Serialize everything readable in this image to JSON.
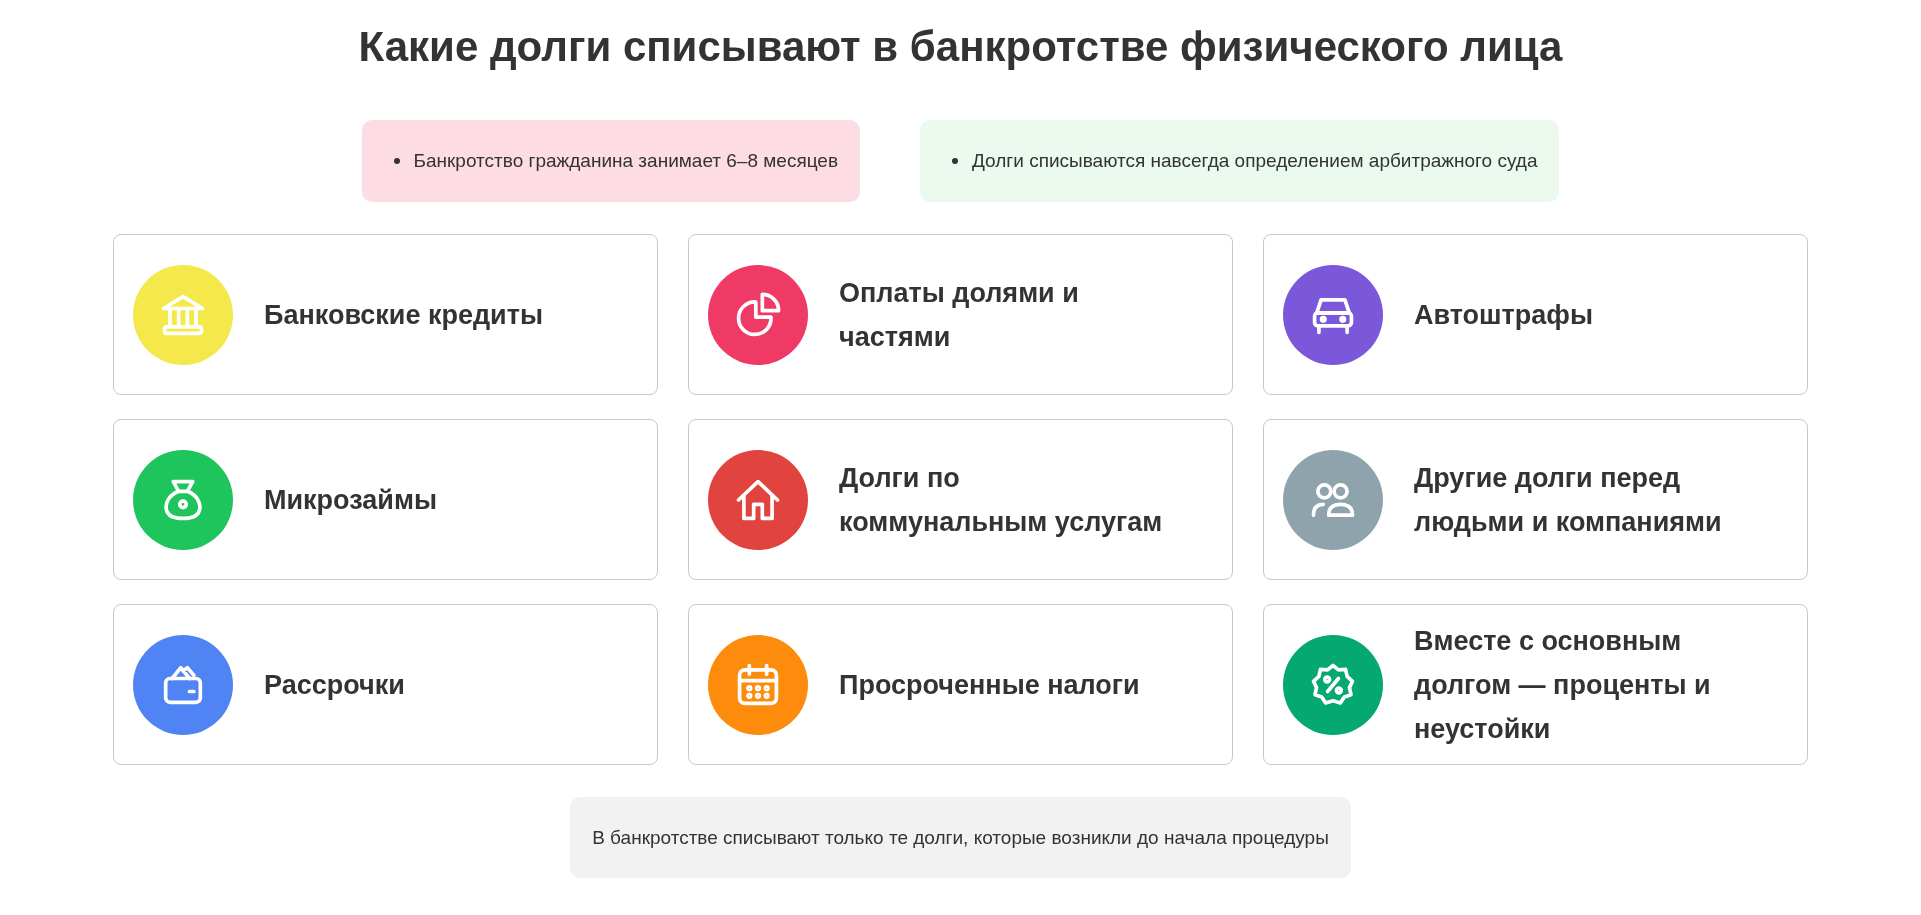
{
  "title": "Какие долги списывают в банкротстве физического лица",
  "notes": [
    {
      "text": "Банкротство гражданина занимает 6–8 месяцев",
      "color": "#fddde3"
    },
    {
      "text": "Долги списываются навсегда определением арбитражного суда",
      "color": "#ebf9ef"
    }
  ],
  "cards": [
    {
      "label": "Банковские кредиты",
      "color": "#f5e84a"
    },
    {
      "label": "Оплаты долями и\nчастями",
      "color": "#f03a66"
    },
    {
      "label": "Автоштрафы",
      "color": "#7b57d9"
    },
    {
      "label": "Микрозаймы",
      "color": "#1dc55c"
    },
    {
      "label": "Долги по\nкоммунальным услугам",
      "color": "#e1433f"
    },
    {
      "label": "Другие долги перед\nлюдьми и компаниями",
      "color": "#8fa3ad"
    },
    {
      "label": "Рассрочки",
      "color": "#5083f3"
    },
    {
      "label": "Просроченные налоги",
      "color": "#fd8c0c"
    },
    {
      "label": "Вместе с основным\nдолгом — проценты и\nнеустойки",
      "color": "#04a870"
    }
  ],
  "footer_note": "В банкротстве списывают только те долги, которые возникли до начала процедуры"
}
